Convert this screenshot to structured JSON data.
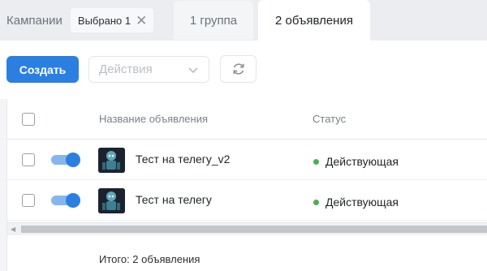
{
  "tabs": {
    "campaigns_label": "Кампании",
    "selected_chip": "Выбрано 1",
    "groups_label": "1 группа",
    "ads_label": "2 объявления"
  },
  "toolbar": {
    "create_label": "Создать",
    "actions_placeholder": "Действия"
  },
  "table": {
    "columns": {
      "name": "Название объявления",
      "status": "Статус"
    },
    "rows": [
      {
        "name": "Тест на телегу_v2",
        "status": "Действующая",
        "enabled": true
      },
      {
        "name": "Тест на телегу",
        "status": "Действующая",
        "enabled": true
      }
    ],
    "total": "Итого: 2 объявления"
  },
  "colors": {
    "accent": "#2b7fe0",
    "status_active": "#4caf50"
  }
}
